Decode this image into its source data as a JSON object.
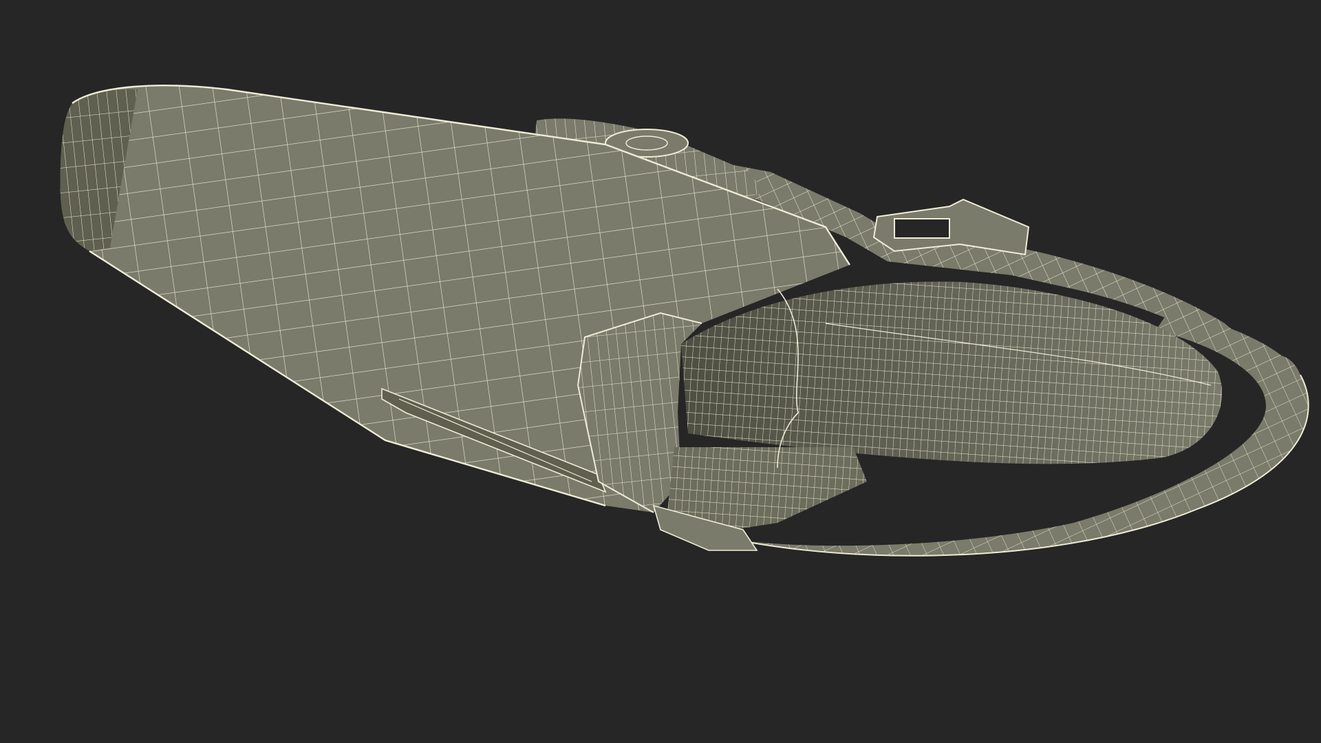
{
  "scene": {
    "background_color": "#262626",
    "surface_color": "#7a7b6b",
    "surface_shadow_color": "#5f604f",
    "wire_color": "#efecd6",
    "subject": "wireframe-3d-model-holster-with-strap"
  }
}
